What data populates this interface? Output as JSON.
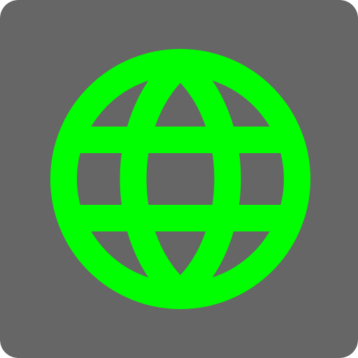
{
  "app_icon": {
    "icon": "globe-icon",
    "colors": {
      "background": "#666666",
      "globe": "#00ff00"
    }
  }
}
